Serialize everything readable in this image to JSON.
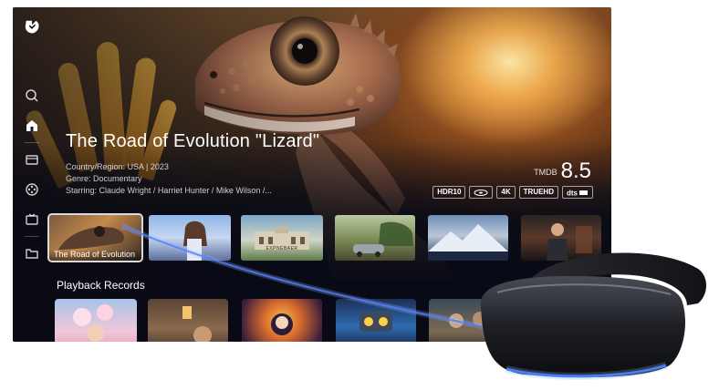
{
  "hero": {
    "title": "The Road of Evolution \"Lizard\"",
    "country_region": "Country/Region: USA | 2023",
    "genre": "Genre: Documentary",
    "starring": "Starring: Claude Wright / Harriet Hunter / Mike Wilson /..."
  },
  "rating": {
    "source": "TMDB",
    "score": "8.5"
  },
  "badges": [
    "HDR10",
    "blu-ray-icon",
    "4K",
    "TRUEHD",
    "dts-hd-icon"
  ],
  "sidebar": {
    "items": [
      {
        "icon": "search-icon"
      },
      {
        "icon": "home-icon",
        "active": true
      },
      {
        "icon": "movie-icon"
      },
      {
        "icon": "film-reel-icon"
      },
      {
        "icon": "tv-icon"
      },
      {
        "icon": "folder-icon"
      }
    ]
  },
  "row1": {
    "cards": [
      {
        "label": "The Road of Evolution",
        "selected": true
      },
      {
        "label": ""
      },
      {
        "label": "",
        "inner_text": "EXPNEBAER"
      },
      {
        "label": ""
      },
      {
        "label": ""
      },
      {
        "label": ""
      }
    ]
  },
  "playback": {
    "title": "Playback Records",
    "cards": [
      {},
      {},
      {},
      {},
      {}
    ]
  },
  "colors": {
    "accent": "#ffffff",
    "background": "#0d0f1a",
    "streak": "#3a6bff"
  }
}
